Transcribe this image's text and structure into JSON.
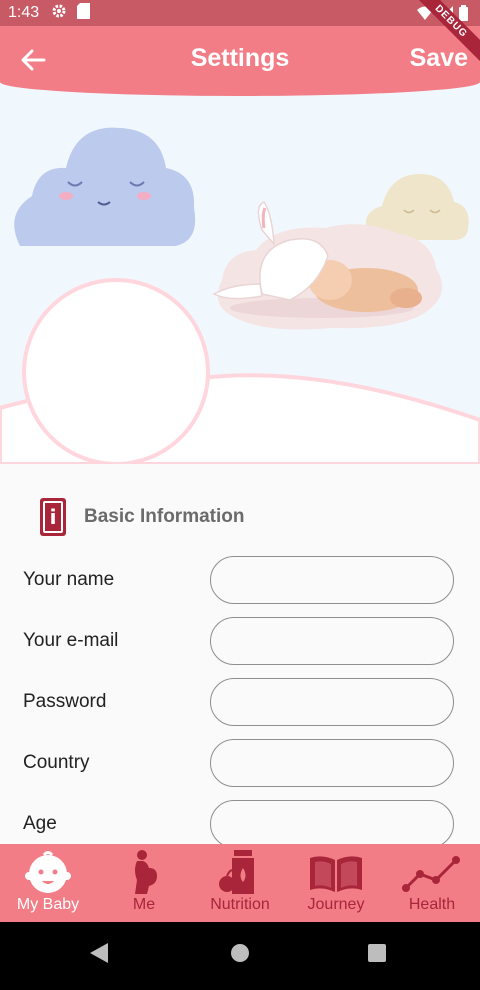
{
  "status_bar": {
    "time": "1:43"
  },
  "debug_banner": {
    "label": "DEBUG"
  },
  "app_bar": {
    "title": "Settings",
    "action_label": "Save"
  },
  "section": {
    "title": "Basic Information"
  },
  "form": {
    "fields": [
      {
        "label": "Your name",
        "value": ""
      },
      {
        "label": "Your e-mail",
        "value": ""
      },
      {
        "label": "Password",
        "value": ""
      },
      {
        "label": "Country",
        "value": ""
      },
      {
        "label": "Age",
        "value": ""
      }
    ]
  },
  "bottom_nav": {
    "items": [
      {
        "label": "My Baby",
        "icon": "baby-face-icon",
        "active": true
      },
      {
        "label": "Me",
        "icon": "pregnant-woman-icon",
        "active": false
      },
      {
        "label": "Nutrition",
        "icon": "nutrition-icon",
        "active": false
      },
      {
        "label": "Journey",
        "icon": "open-book-icon",
        "active": false
      },
      {
        "label": "Health",
        "icon": "line-chart-icon",
        "active": false
      }
    ]
  },
  "colors": {
    "primary": "#f27d87",
    "status_bar": "#c85a66",
    "accent": "#a8253a",
    "background": "#fafafa"
  }
}
